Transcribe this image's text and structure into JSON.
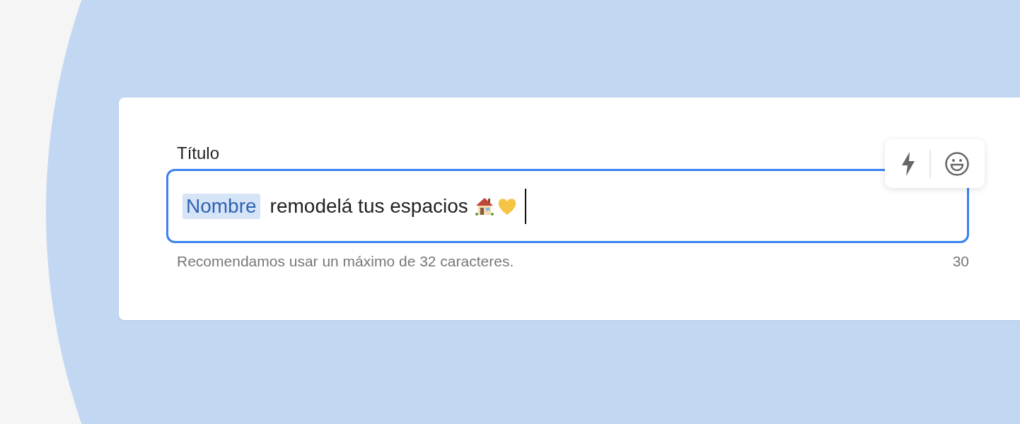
{
  "field": {
    "label": "Título",
    "token": "Nombre",
    "value": "remodelá tus espacios",
    "focused": true
  },
  "hint": "Recomendamos usar un máximo de 32 caracteres.",
  "counter": "30"
}
